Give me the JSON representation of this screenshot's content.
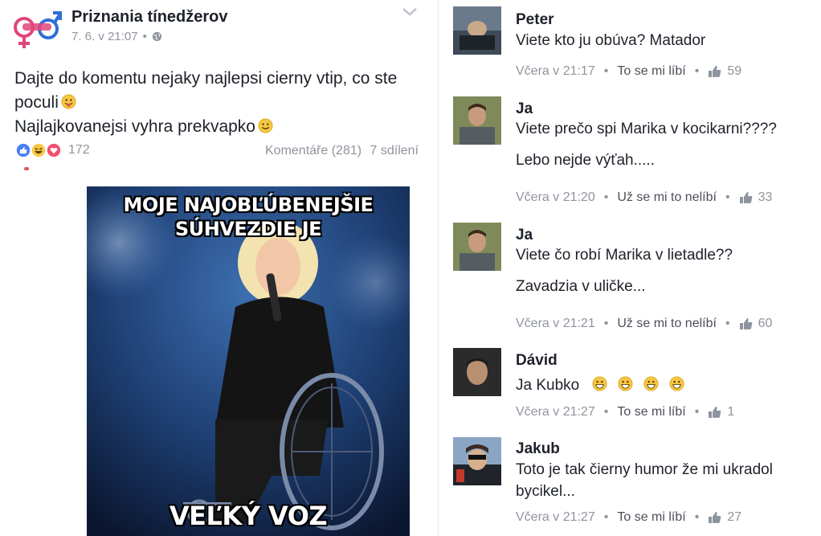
{
  "post": {
    "page_name": "Priznania tínedžerov",
    "date": "7. 6. v 21:07",
    "dot": "•",
    "text_line1": "Dajte do komentu nejaky najlepsi cierny vtip,  co ste",
    "text_line2": "poculi",
    "text_line3": "Najlajkovanejsi vyhra prekvapko",
    "reaction_count": "172",
    "comments_label": "Komentáře (281)",
    "shares_label": "7 sdílení",
    "meme": {
      "top_line1": "MOJE NAJOBĽÚBENEJŠIE",
      "top_line2": "SÚHVEZDIE JE",
      "bottom": "VEĽKÝ VOZ"
    }
  },
  "comments": [
    {
      "name": "Peter",
      "lines": [
        "Viete kto ju obúva? Matador"
      ],
      "time": "Včera v 21:17",
      "like_action": "To se mi líbí",
      "likes": "59"
    },
    {
      "name": "Ja",
      "lines": [
        "Viete prečo spi Marika v kocikarni????",
        "",
        "Lebo nejde výťah....."
      ],
      "time": "Včera v 21:20",
      "like_action": "Už se mi to nelíbí",
      "likes": "33"
    },
    {
      "name": "Ja",
      "lines": [
        "Viete čo robí Marika v lietadle??",
        "",
        "Zavadzia v uličke..."
      ],
      "time": "Včera v 21:21",
      "like_action": "Už se mi to nelíbí",
      "likes": "60"
    },
    {
      "name": "Dávid",
      "lines": [
        "Ja Kubko"
      ],
      "time": "Včera v 21:27",
      "like_action": "To se mi líbí",
      "likes": "1"
    },
    {
      "name": "Jakub",
      "lines": [
        "Toto je tak čierny humor že mi ukradol",
        "bycikel..."
      ],
      "time": "Včera v 21:27",
      "like_action": "To se mi líbí",
      "likes": "27"
    }
  ],
  "meta_sep": "•",
  "colors": {
    "link_blue": "#3b5998",
    "meta_gray": "#90949c",
    "text": "#1d2129"
  }
}
